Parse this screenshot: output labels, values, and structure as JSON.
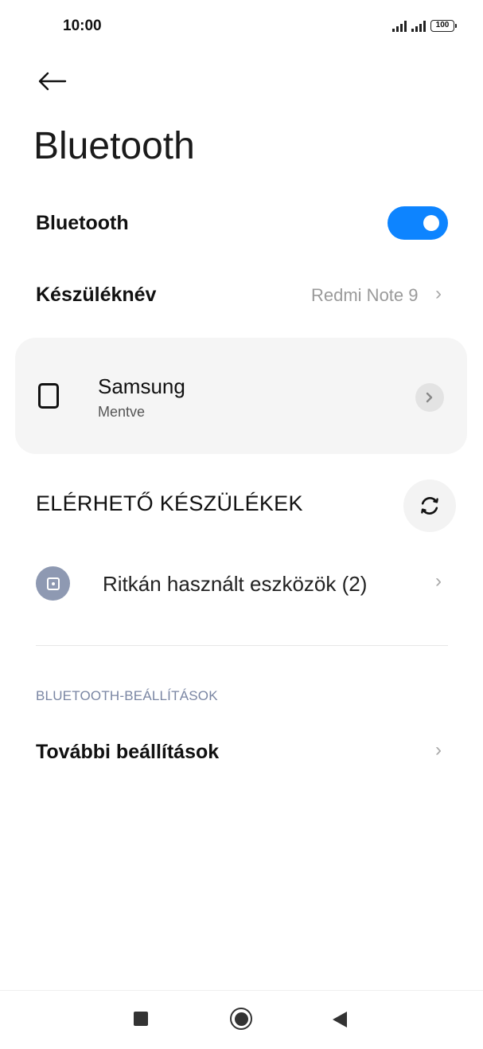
{
  "status_bar": {
    "time": "10:00",
    "battery": "100"
  },
  "header": {
    "back_icon": "arrow-left-icon",
    "title": "Bluetooth"
  },
  "bluetooth_toggle": {
    "label": "Bluetooth",
    "state": "on",
    "color": "#0d84ff"
  },
  "device_name_row": {
    "label": "Készüléknév",
    "value": "Redmi Note 9",
    "chevron": "›"
  },
  "paired_devices": [
    {
      "name": "Samsung",
      "status": "Mentve",
      "icon": "device-icon",
      "detail_chevron": "›"
    }
  ],
  "available_devices": {
    "header": "ELÉRHETŐ KÉSZÜLÉKEK",
    "refresh_icon": "refresh-icon",
    "rarely_used": {
      "label": "Ritkán használt eszközök (2)",
      "chevron": "›"
    }
  },
  "bluetooth_settings": {
    "header": "BLUETOOTH-BEÁLLÍTÁSOK",
    "more_settings": {
      "label": "További beállítások",
      "chevron": "›"
    }
  },
  "nav_bar": {
    "recent": "square-icon",
    "home": "circle-icon",
    "back": "triangle-left-icon"
  }
}
